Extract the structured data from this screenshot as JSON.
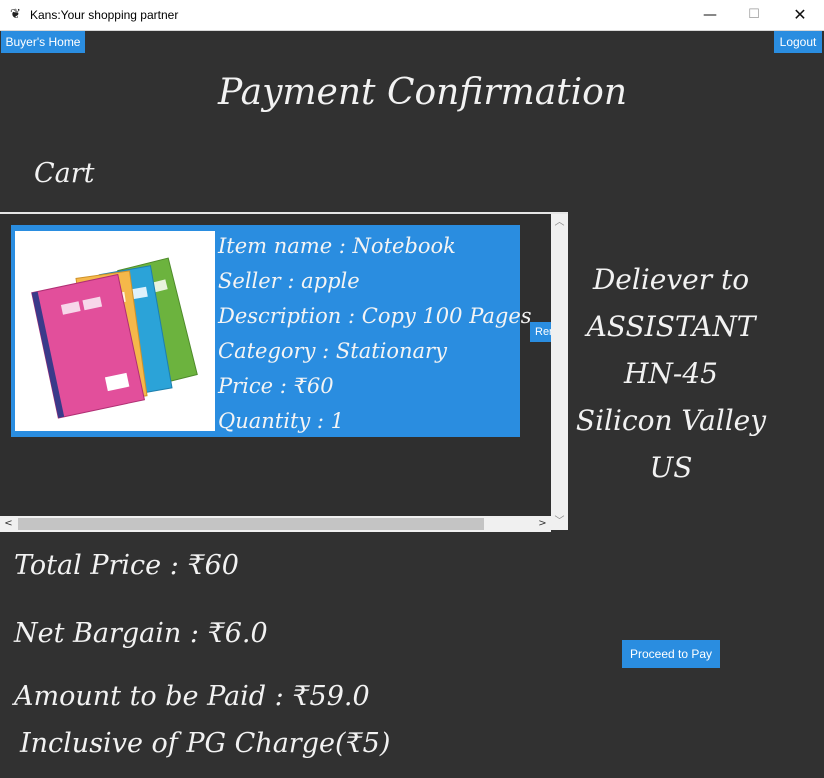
{
  "window": {
    "title": "Kans:Your shopping partner",
    "icon": "app-icon",
    "controls": {
      "minimize": "—",
      "maximize": "☐",
      "close": "✕"
    }
  },
  "nav": {
    "home_label": "Buyer's Home",
    "logout_label": "Logout"
  },
  "page": {
    "title": "Payment Confirmation",
    "cart_heading": "Cart"
  },
  "cart": {
    "items": [
      {
        "image": "notebooks-image",
        "lines": [
          "Item name : Notebook",
          "Seller : apple",
          "Description : Copy 100 Pages",
          "Category : Stationary",
          "Price : ₹60",
          "Quantity : 1"
        ],
        "remove_label": "Remove"
      }
    ]
  },
  "delivery": {
    "heading": "Deliever to",
    "name": "ASSISTANT",
    "house": "HN-45",
    "city": "Silicon Valley",
    "country": "US"
  },
  "summary": {
    "total": "Total Price : ₹60",
    "bargain": "Net Bargain : ₹6.0",
    "amount": "Amount to be Paid : ₹59.0",
    "pg_note": "Inclusive of PG Charge(₹5)"
  },
  "actions": {
    "pay_label": "Proceed to Pay"
  },
  "colors": {
    "background": "#313131",
    "accent": "#2a8de0",
    "text": "#f2f2f2"
  }
}
